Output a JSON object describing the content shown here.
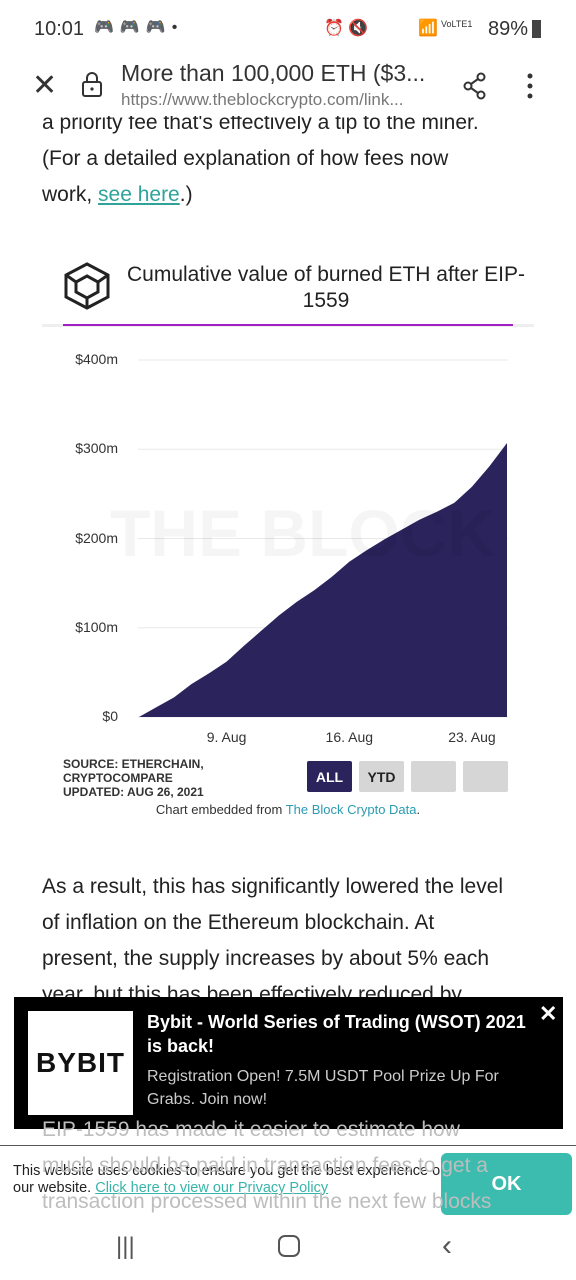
{
  "status_bar": {
    "time": "10:01",
    "network": "VoLTE1",
    "battery": "89%"
  },
  "browser": {
    "title": "More than 100,000 ETH ($3...",
    "url": "https://www.theblockcrypto.com/link..."
  },
  "article": {
    "lines_top": [
      "a priority fee that's effectively a tip to the miner.",
      "(For a detailed explanation of how fees now"
    ],
    "line3_prefix": "work, ",
    "link": "see here",
    "line3_suffix": ".)",
    "lines_mid": [
      "As a result, this has significantly lowered the level",
      "of inflation on the Ethereum blockchain. At",
      "present, the supply increases by about 5% each",
      "year, but this has been effectively reduced by"
    ],
    "lines_bottom": [
      "EIP-1559 has made it easier to estimate how",
      "much should be paid in transaction fees to get a",
      "transaction processed within the next few blocks"
    ]
  },
  "chart_data": {
    "type": "area",
    "title": "Cumulative value of burned ETH after EIP-1559",
    "watermark": "THE BLOCK",
    "x": [
      "Aug 4",
      "Aug 5",
      "Aug 6",
      "Aug 7",
      "Aug 8",
      "Aug 9",
      "Aug 10",
      "Aug 11",
      "Aug 12",
      "Aug 13",
      "Aug 14",
      "Aug 15",
      "Aug 16",
      "Aug 17",
      "Aug 18",
      "Aug 19",
      "Aug 20",
      "Aug 21",
      "Aug 22",
      "Aug 23",
      "Aug 24",
      "Aug 25"
    ],
    "values": [
      0,
      11,
      22,
      37,
      49,
      62,
      80,
      97,
      114,
      129,
      142,
      157,
      174,
      187,
      199,
      210,
      221,
      230,
      240,
      258,
      281,
      307
    ],
    "yunit": "$m",
    "ylim": [
      0,
      400
    ],
    "yticks": [
      "$0",
      "$100m",
      "$200m",
      "$300m",
      "$400m"
    ],
    "xticks": [
      "9. Aug",
      "16. Aug",
      "23. Aug"
    ],
    "grid": true,
    "color": "#2a235c",
    "source": [
      "SOURCE: ETHERCHAIN,",
      "CRYPTOCOMPARE",
      "UPDATED: AUG 26, 2021"
    ],
    "ranges": [
      "ALL",
      "YTD",
      "",
      ""
    ],
    "embed_prefix": "Chart embedded from ",
    "embed_link": "The Block Crypto Data",
    "embed_suffix": "."
  },
  "ad": {
    "logo": "BYBIT",
    "title": "Bybit - World Series of Trading (WSOT) 2021 is back!",
    "body": "Registration Open! 7.5M USDT Pool Prize Up For Grabs. Join now!"
  },
  "cookie": {
    "text": "This website uses cookies to ensure you get the best experience on our website. ",
    "link": "Click here to view our Privacy Policy",
    "ok": "OK"
  }
}
